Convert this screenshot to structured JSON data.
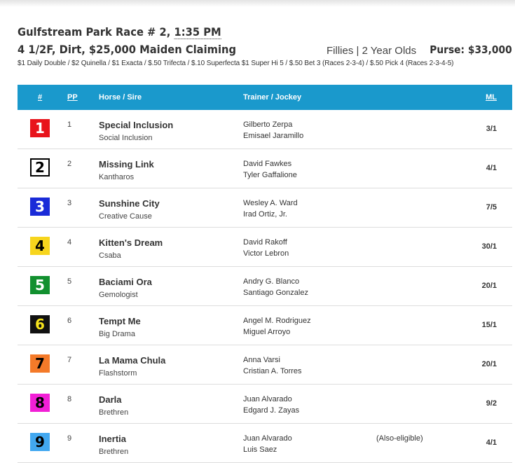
{
  "race": {
    "title_prefix": "Gulfstream Park Race # 2, ",
    "post_time": "1:35 PM",
    "subtitle": "4 1/2F, Dirt, $25,000 Maiden Claiming",
    "conditions": "Fillies | 2 Year Olds",
    "purse": "Purse: $33,000",
    "wagers": "$1 Daily Double / $2 Quinella / $1 Exacta / $.50 Trifecta / $.10 Superfecta $1 Super Hi 5 / $.50 Bet 3 (Races 2-3-4) / $.50 Pick 4 (Races 2-3-4-5)"
  },
  "columns": {
    "program": "#",
    "pp": "PP",
    "horse_sire": "Horse / Sire",
    "trainer_jockey": "Trainer / Jockey",
    "ml": "ML"
  },
  "colors": {
    "header_bg": "#1a99cc"
  },
  "entries": [
    {
      "number": "1",
      "pp": "1",
      "horse": "Special Inclusion",
      "sire": "Social Inclusion",
      "trainer": "Gilberto Zerpa",
      "jockey": "Emisael Jaramillo",
      "note": "",
      "ml": "3/1",
      "bg": "#e8131b",
      "fg": "#ffffff",
      "border": "#e8131b"
    },
    {
      "number": "2",
      "pp": "2",
      "horse": "Missing Link",
      "sire": "Kantharos",
      "trainer": "David Fawkes",
      "jockey": "Tyler Gaffalione",
      "note": "",
      "ml": "4/1",
      "bg": "#ffffff",
      "fg": "#000000",
      "border": "#000000"
    },
    {
      "number": "3",
      "pp": "3",
      "horse": "Sunshine City",
      "sire": "Creative Cause",
      "trainer": "Wesley A. Ward",
      "jockey": "Irad Ortiz, Jr.",
      "note": "",
      "ml": "7/5",
      "bg": "#1a2bd8",
      "fg": "#ffffff",
      "border": "#1a2bd8"
    },
    {
      "number": "4",
      "pp": "4",
      "horse": "Kitten's Dream",
      "sire": "Csaba",
      "trainer": "David Rakoff",
      "jockey": "Victor Lebron",
      "note": "",
      "ml": "30/1",
      "bg": "#f7d51d",
      "fg": "#000000",
      "border": "#f7d51d"
    },
    {
      "number": "5",
      "pp": "5",
      "horse": "Baciami Ora",
      "sire": "Gemologist",
      "trainer": "Andry G. Blanco",
      "jockey": "Santiago Gonzalez",
      "note": "",
      "ml": "20/1",
      "bg": "#12902f",
      "fg": "#ffffff",
      "border": "#12902f"
    },
    {
      "number": "6",
      "pp": "6",
      "horse": "Tempt Me",
      "sire": "Big Drama",
      "trainer": "Angel M. Rodriguez",
      "jockey": "Miguel Arroyo",
      "note": "",
      "ml": "15/1",
      "bg": "#111111",
      "fg": "#f7e41d",
      "border": "#111111"
    },
    {
      "number": "7",
      "pp": "7",
      "horse": "La Mama Chula",
      "sire": "Flashstorm",
      "trainer": "Anna Varsi",
      "jockey": "Cristian A. Torres",
      "note": "",
      "ml": "20/1",
      "bg": "#f47a29",
      "fg": "#000000",
      "border": "#f47a29"
    },
    {
      "number": "8",
      "pp": "8",
      "horse": "Darla",
      "sire": "Brethren",
      "trainer": "Juan Alvarado",
      "jockey": "Edgard J. Zayas",
      "note": "",
      "ml": "9/2",
      "bg": "#f21fd6",
      "fg": "#000000",
      "border": "#f21fd6"
    },
    {
      "number": "9",
      "pp": "9",
      "horse": "Inertia",
      "sire": "Brethren",
      "trainer": "Juan Alvarado",
      "jockey": "Luis Saez",
      "note": "(Also-eligible)",
      "ml": "4/1",
      "bg": "#42a8f0",
      "fg": "#000000",
      "border": "#42a8f0"
    }
  ]
}
